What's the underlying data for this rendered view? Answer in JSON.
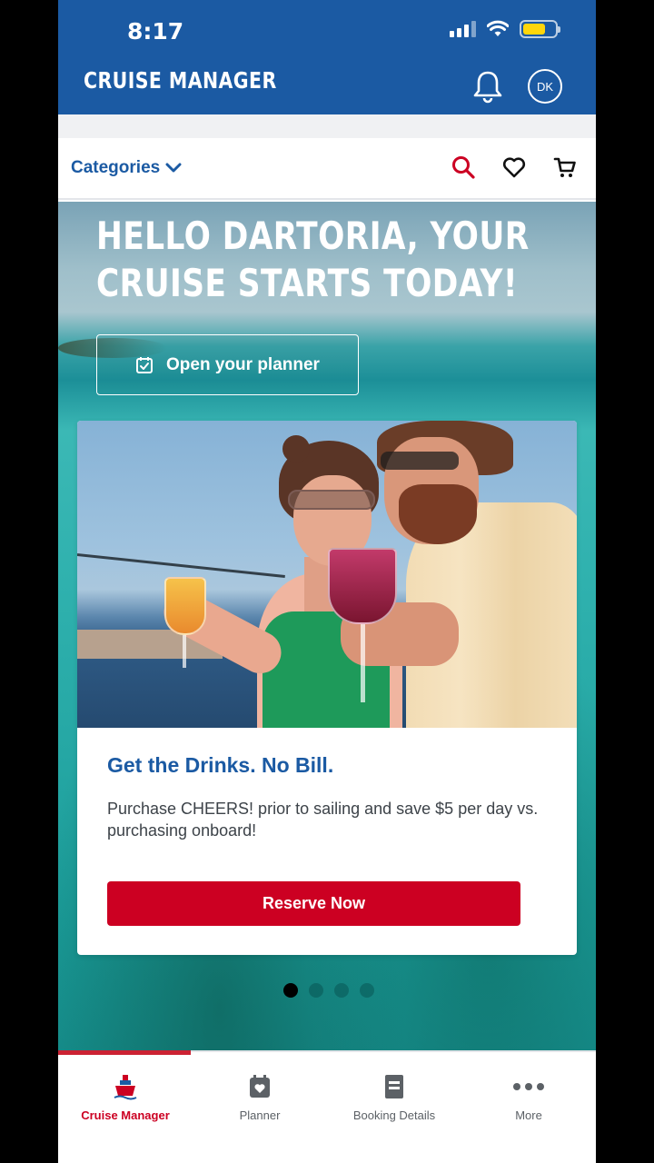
{
  "status_bar": {
    "time": "8:17"
  },
  "header": {
    "title": "CRUISE MANAGER",
    "avatar_initials": "DK"
  },
  "navbar": {
    "categories_label": "Categories"
  },
  "hero": {
    "title": "HELLO DARTORIA, YOUR CRUISE STARTS TODAY!",
    "planner_button": "Open your planner"
  },
  "promo": {
    "title": "Get the Drinks. No Bill.",
    "text": "Purchase CHEERS! prior to sailing and save $5 per day vs. purchasing onboard!",
    "button": "Reserve Now"
  },
  "carousel": {
    "page_count": 4,
    "active_index": 0
  },
  "tabs": [
    {
      "label": "Cruise Manager",
      "icon": "ship-icon",
      "active": true
    },
    {
      "label": "Planner",
      "icon": "calendar-heart-icon",
      "active": false
    },
    {
      "label": "Booking Details",
      "icon": "document-icon",
      "active": false
    },
    {
      "label": "More",
      "icon": "more-dots-icon",
      "active": false
    }
  ],
  "colors": {
    "brand_blue": "#1b5aa3",
    "accent_red": "#cc0022",
    "battery_yellow": "#ffd60a"
  }
}
